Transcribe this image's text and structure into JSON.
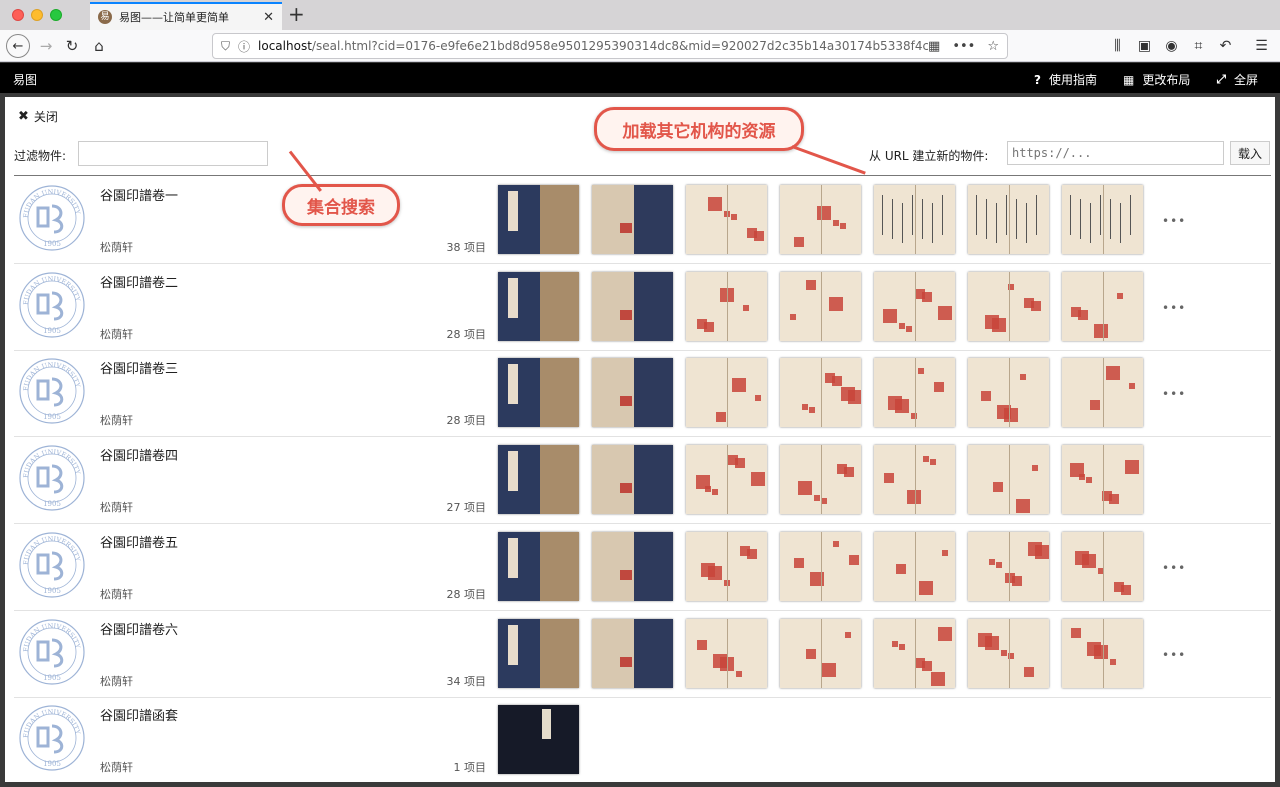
{
  "browser": {
    "tab_title": "易图——让简单更简单",
    "favicon_glyph": "易",
    "url_host": "localhost",
    "url_path": "/seal.html?cid=0176-e9fe6e21bd8d958e9501295390314dc8&mid=920027d2c35b14a30174b5338f4cd7ea"
  },
  "app": {
    "title": "易图",
    "help_label": "使用指南",
    "layout_label": "更改布局",
    "fullscreen_label": "全屏"
  },
  "panel": {
    "close_label": "关闭",
    "filter_label": "过滤物件:",
    "filter_value": "",
    "url_label": "从 URL 建立新的物件:",
    "url_placeholder": "https://...",
    "load_label": "载入"
  },
  "annotations": {
    "search_note": "集合搜索",
    "resources_note": "加载其它机构的资源",
    "accent_color": "#e2564a"
  },
  "logo": {
    "arc_text": "FUDAN UNIVERSITY",
    "year": "1905",
    "color": "#9db3d6"
  },
  "collections": [
    {
      "title": "谷園印譜卷一",
      "owner": "松荫轩",
      "count": "38 项目",
      "more": "•••"
    },
    {
      "title": "谷園印譜卷二",
      "owner": "松荫轩",
      "count": "28 项目",
      "more": "•••"
    },
    {
      "title": "谷園印譜卷三",
      "owner": "松荫轩",
      "count": "28 项目",
      "more": "•••"
    },
    {
      "title": "谷園印譜卷四",
      "owner": "松荫轩",
      "count": "27 项目",
      "more": ""
    },
    {
      "title": "谷園印譜卷五",
      "owner": "松荫轩",
      "count": "28 项目",
      "more": "•••"
    },
    {
      "title": "谷園印譜卷六",
      "owner": "松荫轩",
      "count": "34 项目",
      "more": "•••"
    },
    {
      "title": "谷園印譜函套",
      "owner": "松荫轩",
      "count": "1 项目",
      "more": ""
    }
  ]
}
